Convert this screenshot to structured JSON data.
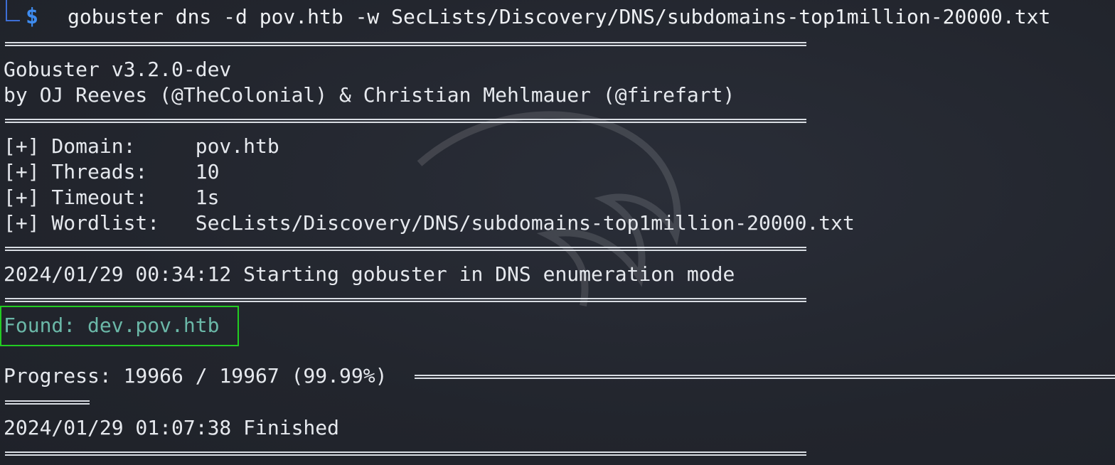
{
  "prompt": {
    "symbol": "$",
    "command": "gobuster dns -d pov.htb -w SecLists/Discovery/DNS/subdomains-top1million-20000.txt"
  },
  "banner": {
    "version_line": "Gobuster v3.2.0-dev",
    "authors_line": "by OJ Reeves (@TheColonial) & Christian Mehlmauer (@firefart)"
  },
  "config": [
    {
      "key": "[+] Domain:     ",
      "value": "pov.htb"
    },
    {
      "key": "[+] Threads:    ",
      "value": "10"
    },
    {
      "key": "[+] Timeout:    ",
      "value": "1s"
    },
    {
      "key": "[+] Wordlist:   ",
      "value": "SecLists/Discovery/DNS/subdomains-top1million-20000.txt"
    }
  ],
  "start_line": "2024/01/29 00:34:12 Starting gobuster in DNS enumeration mode",
  "found_line": "Found: dev.pov.htb",
  "progress": {
    "label": "Progress: 19966 / 19967 (99.99%)",
    "fraction": 0.9999
  },
  "finished_line": "2024/01/29 01:07:38 Finished",
  "colors": {
    "background": "#23262f",
    "text": "#e6e9ee",
    "prompt": "#3e8cf0",
    "found": "#6bb8a8",
    "highlight_box": "#22cc22"
  }
}
